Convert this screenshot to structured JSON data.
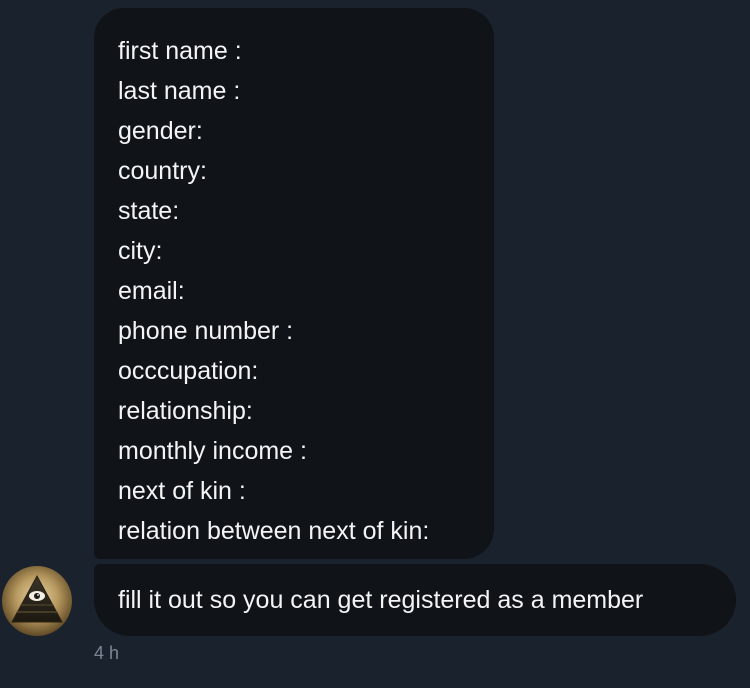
{
  "conversation": {
    "form_lines": [
      "first name :",
      "last name :",
      "gender:",
      "country:",
      "state:",
      "city:",
      "email:",
      "phone number :",
      "occcupation:",
      "relationship:",
      "monthly income :",
      "next of kin :",
      "relation between next of kin:"
    ],
    "message": "fill it out so you can get registered as a member",
    "timestamp": "4 h",
    "avatar_icon": "illuminati-pyramid-eye-icon"
  },
  "colors": {
    "background": "#1a222d",
    "bubble": "#101419",
    "text": "#f2f4f6",
    "timestamp": "#7d8793"
  }
}
